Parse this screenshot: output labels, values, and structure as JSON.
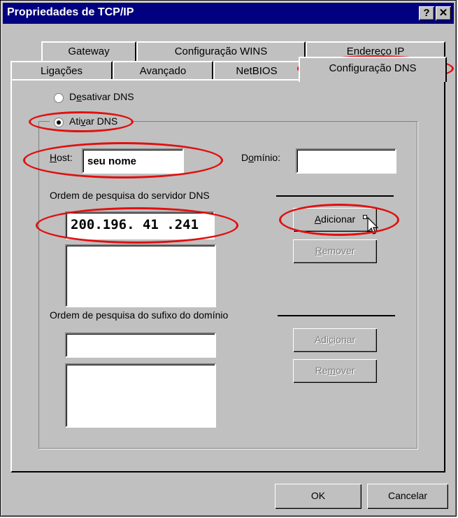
{
  "window": {
    "title": "Propriedades de TCP/IP",
    "help_glyph": "?",
    "close_glyph": "✕"
  },
  "tabs_back": [
    {
      "label": "Gateway"
    },
    {
      "label": "Configuração WINS"
    },
    {
      "label": "Endereço IP"
    }
  ],
  "tabs_front": [
    {
      "label": "Ligações"
    },
    {
      "label": "Avançado"
    },
    {
      "label": "NetBIOS"
    },
    {
      "label": "Configuração DNS",
      "active": true
    }
  ],
  "dns": {
    "disable_label_pre": "D",
    "disable_label_key": "e",
    "disable_label_post": "sativar DNS",
    "enable_label_pre": "Ati",
    "enable_label_key": "v",
    "enable_label_post": "ar DNS",
    "selected": "enable",
    "host_label_key": "H",
    "host_label_post": "ost:",
    "host_value": "seu nome",
    "domain_label_pre": "D",
    "domain_label_key": "o",
    "domain_label_post": "mínio:",
    "domain_value": "",
    "server_order_label": "Ordem de pesquisa do servidor DNS",
    "ip_value": "200.196. 41 .241",
    "add_label_key": "A",
    "add_label_post": "dicionar",
    "remove_label_key": "R",
    "remove_label_post": "emover",
    "suffix_order_label": "Ordem de pesquisa do sufixo do domínio",
    "suffix_value": "",
    "add2_label_pre": "Adi",
    "add2_label_key": "c",
    "add2_label_post": "ionar",
    "remove2_label_pre": "Re",
    "remove2_label_key": "m",
    "remove2_label_post": "over"
  },
  "footer": {
    "ok_label": "OK",
    "cancel_label": "Cancelar"
  },
  "colors": {
    "title_bar": "#000080",
    "face": "#c0c0c0",
    "highlight_annotation": "#e01010"
  }
}
